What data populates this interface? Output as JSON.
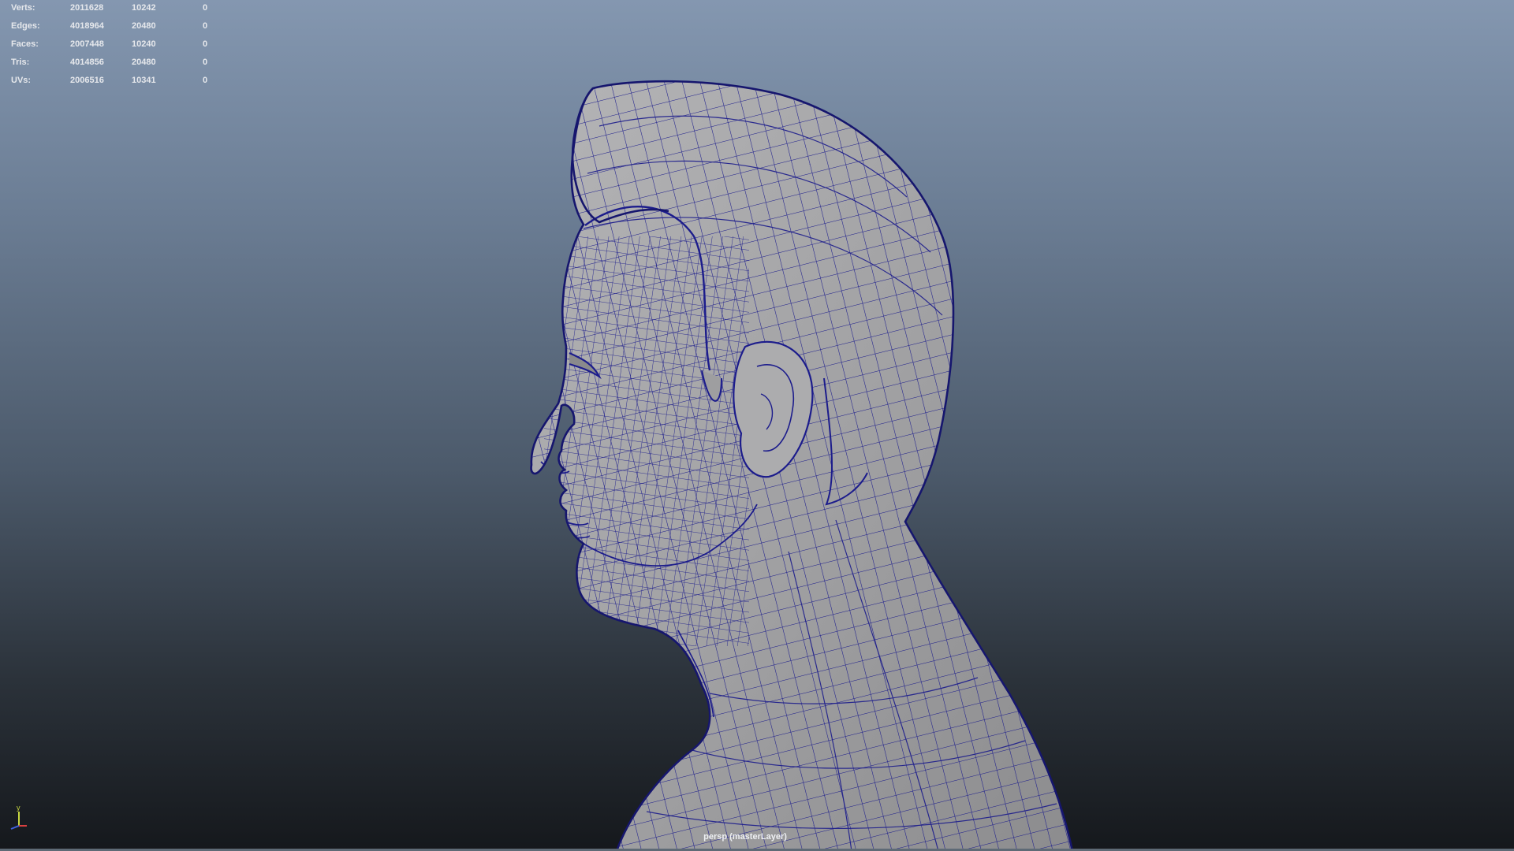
{
  "heads_up_display": {
    "rows": [
      {
        "label": "Verts:",
        "total": "2011628",
        "selected": "10242",
        "components": "0"
      },
      {
        "label": "Edges:",
        "total": "4018964",
        "selected": "20480",
        "components": "0"
      },
      {
        "label": "Faces:",
        "total": "2007448",
        "selected": "10240",
        "components": "0"
      },
      {
        "label": "Tris:",
        "total": "4014856",
        "selected": "20480",
        "components": "0"
      },
      {
        "label": "UVs:",
        "total": "2006516",
        "selected": "10341",
        "components": "0"
      }
    ]
  },
  "viewport": {
    "camera_label": "persp (masterLayer)",
    "background_top": "#8497b0",
    "background_bottom": "#15181c"
  },
  "model": {
    "subject": "head-bust-profile",
    "surface_color": "#a6a6a8",
    "wireframe_color": "#1c1c8c"
  },
  "axis_gizmo": {
    "y_label": "y",
    "y_color": "#c8d840",
    "x_color": "#d84040",
    "z_color": "#4060e0"
  }
}
